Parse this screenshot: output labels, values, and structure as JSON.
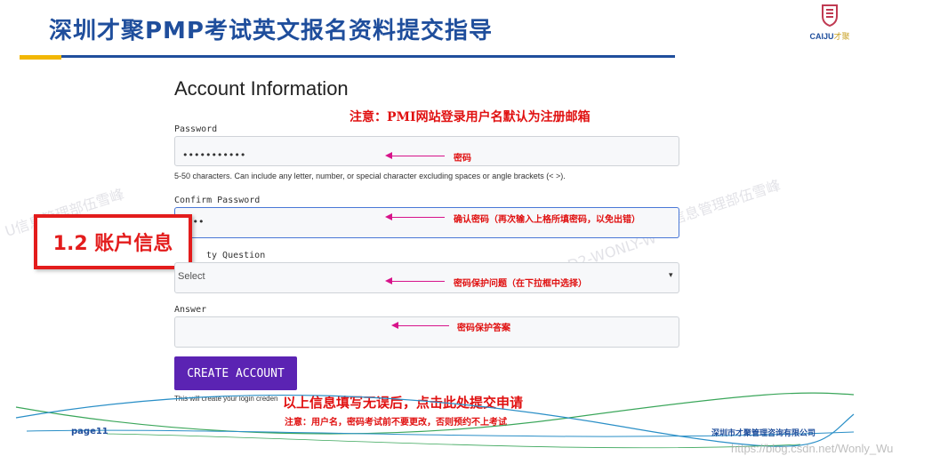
{
  "slide": {
    "title": "深圳才聚PMP考试英文报名资料提交指导",
    "logo_text": "CAIJU",
    "logo_text_suffix": "才聚",
    "section_label": "1.2 账户信息"
  },
  "form": {
    "heading": "Account Information",
    "username_note": "注意：PMI网站登录用户名默认为注册邮箱",
    "password": {
      "label": "Password",
      "value": "•••••••••••",
      "hint": "5-50 characters. Can include any letter, number, or special character excluding spaces or angle brackets (< >).",
      "annotation": "密码"
    },
    "confirm_password": {
      "label": "Confirm Password",
      "value": "•••",
      "annotation": "确认密码（再次输入上格所填密码，以免出错）"
    },
    "security_question": {
      "label": "Security Question",
      "label_visible": "ty Question",
      "selected": "Select",
      "annotation": "密码保护问题（在下拉框中选择）"
    },
    "answer": {
      "label": "Answer",
      "value": "",
      "annotation": "密码保护答案"
    },
    "create_button": "CREATE ACCOUNT",
    "login_hint": "This will create your login creden",
    "submit_note": "以上信息填写无误后，点击此处提交申请",
    "submit_warning": "注意：用户名，密码考试前不要更改，否则预约不上考试"
  },
  "footer": {
    "page": "page11",
    "company": "深圳市才聚管理咨询有限公司"
  },
  "watermarks": {
    "left": "U信息管理部伍雪峰",
    "right": "U信息管理部伍雪峰",
    "center": "D2-WONLY-W",
    "url": "https://blog.csdn.net/Wonly_Wu"
  },
  "colors": {
    "title_blue": "#1f4e9c",
    "accent_yellow": "#f2b705",
    "annotation_red": "#e01010",
    "arrow_magenta": "#d7138a",
    "button_purple": "#5b23b3"
  },
  "icons": {
    "select_chevron": "chevron-down-icon",
    "arrows": "arrow-left-icon"
  }
}
